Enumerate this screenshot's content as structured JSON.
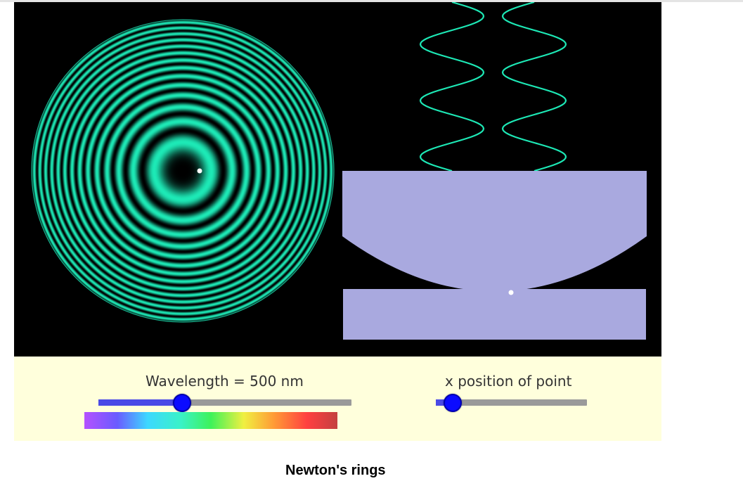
{
  "simulation": {
    "wavelength_label": "Wavelength = 500 nm",
    "wavelength_nm": 500,
    "wavelength_slider_fraction": 0.33,
    "position_label": "x position of point",
    "position_slider_fraction": 0.11,
    "spectrum_colors": [
      "#b450ff",
      "#6a5cff",
      "#3dd8ff",
      "#3af2c8",
      "#3ef25a",
      "#f0f040",
      "#ff9a36",
      "#ff4040",
      "#c44040"
    ]
  },
  "colors": {
    "ring": "#1de9b6",
    "wave": "#1de9b6",
    "glass": "#a9a9df",
    "track": "#9a9a9a",
    "track_fill": "#4a4ae6",
    "thumb": "#0b0bff",
    "panel": "#ffffdc"
  },
  "caption": "Newton's rings"
}
